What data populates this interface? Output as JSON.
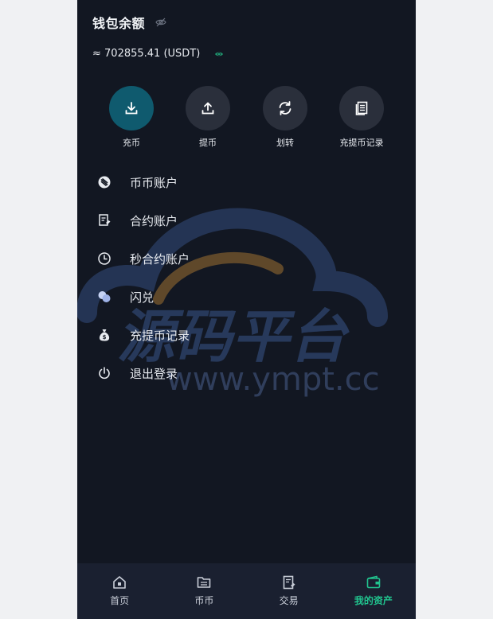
{
  "wallet": {
    "title": "钱包余额",
    "balance": "≈ 702855.41 (USDT)"
  },
  "actions": [
    {
      "label": "充币",
      "icon": "download-icon"
    },
    {
      "label": "提币",
      "icon": "upload-icon"
    },
    {
      "label": "划转",
      "icon": "refresh-icon"
    },
    {
      "label": "充提币记录",
      "icon": "document-icon"
    }
  ],
  "menu": [
    {
      "label": "币币账户",
      "icon": "coin-icon"
    },
    {
      "label": "合约账户",
      "icon": "contract-icon"
    },
    {
      "label": "秒合约账户",
      "icon": "clock-icon"
    },
    {
      "label": "闪兑",
      "icon": "exchange-icon"
    },
    {
      "label": "充提币记录",
      "icon": "money-bag-icon"
    },
    {
      "label": "退出登录",
      "icon": "power-icon"
    }
  ],
  "watermark": {
    "title": "源码平台",
    "url": "www.ympt.cc"
  },
  "tabs": [
    {
      "label": "首页",
      "icon": "home-icon"
    },
    {
      "label": "币币",
      "icon": "folder-icon"
    },
    {
      "label": "交易",
      "icon": "trade-icon"
    },
    {
      "label": "我的资产",
      "icon": "wallet-icon",
      "active": true
    }
  ],
  "colors": {
    "background": "#121722",
    "primary_action": "#0f5a6e",
    "accent_green": "#21c38e",
    "tabbar": "#1a2030"
  }
}
